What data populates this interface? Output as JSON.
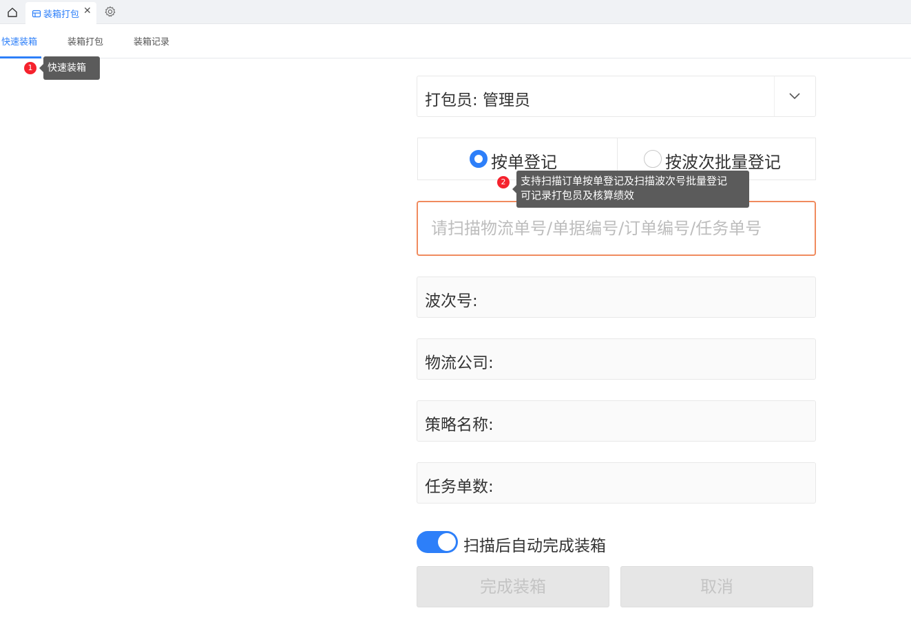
{
  "tabs": {
    "active_label": "装箱打包",
    "close_glyph": "✕"
  },
  "subnav": {
    "items": [
      "快速装箱",
      "装箱打包",
      "装箱记录"
    ],
    "active_index": 0
  },
  "guide": {
    "step1": {
      "number": "1",
      "text": "快速装箱"
    },
    "step2": {
      "number": "2",
      "line1": "支持扫描订单按单登记及扫描波次号批量登记",
      "line2": "可记录打包员及核算绩效"
    }
  },
  "form": {
    "packer_select": "打包员: 管理员",
    "mode": {
      "options": [
        "按单登记",
        "按波次批量登记"
      ],
      "selected_index": 0
    },
    "scan_placeholder": "请扫描物流单号/单据编号/订单编号/任务单号",
    "info_fields": [
      "波次号:",
      "物流公司:",
      "策略名称:",
      "任务单数:"
    ],
    "auto_complete": {
      "label": "扫描后自动完成装箱",
      "enabled": true
    },
    "buttons": {
      "complete": "完成装箱",
      "cancel": "取消"
    }
  },
  "colors": {
    "accent": "#2d7ff9",
    "scan_border": "#f08a5d",
    "step_badge": "#f5222d",
    "tooltip_bg": "#5b5b5b"
  },
  "icons": [
    "home-icon",
    "package-icon",
    "close-icon",
    "gear-icon",
    "chevron-down-icon"
  ]
}
